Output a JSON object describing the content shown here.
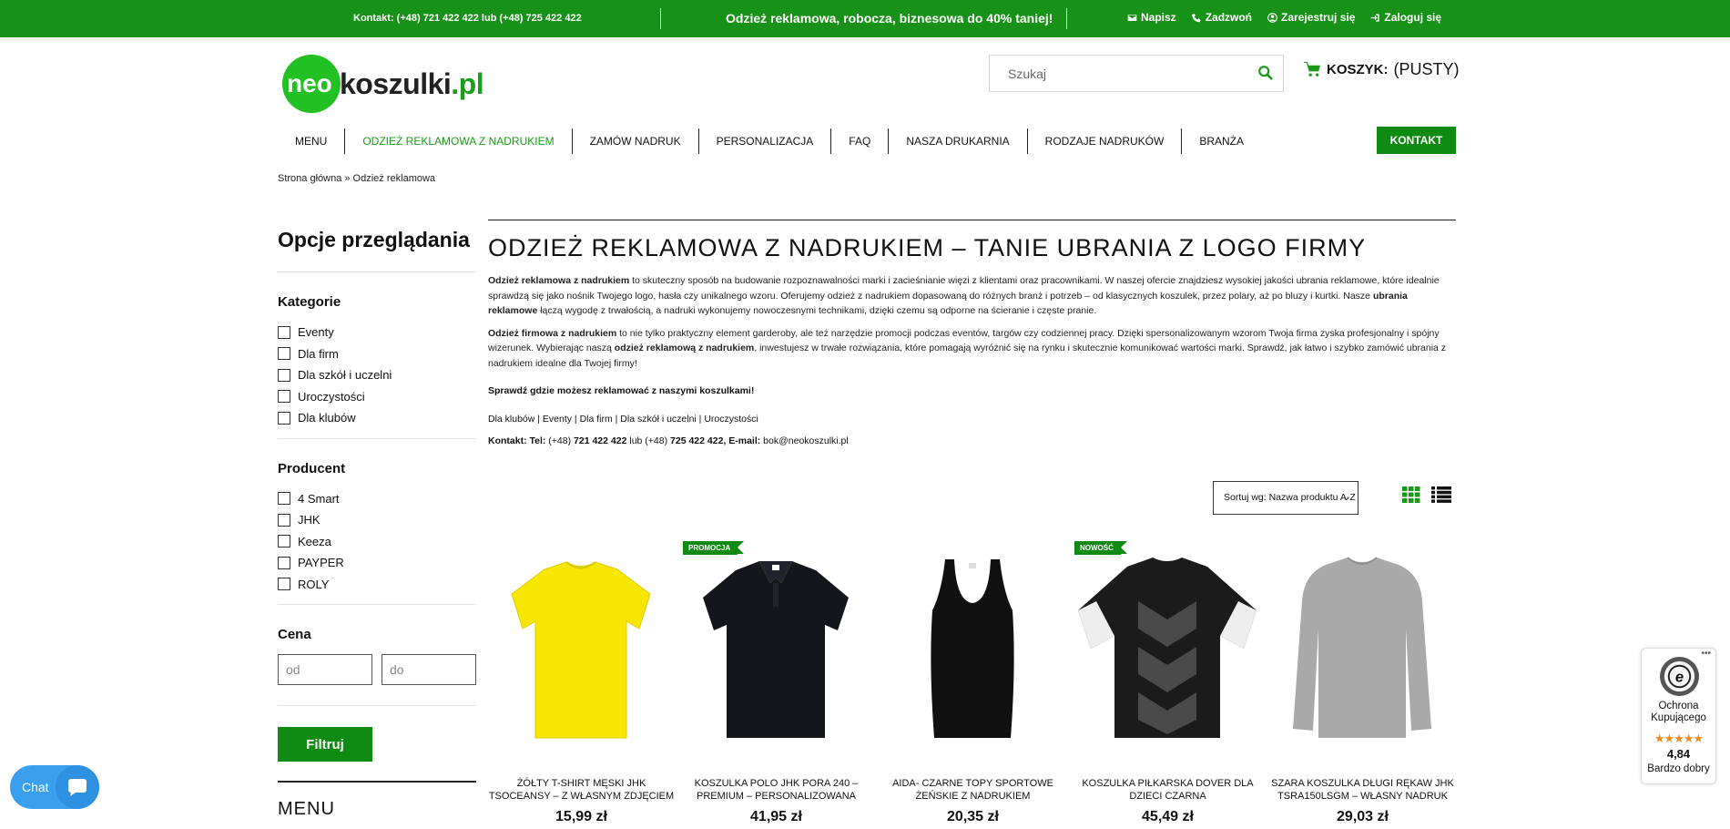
{
  "topbar": {
    "contact": "Kontakt: (+48) 721 422 422 lub (+48) 725 422 422",
    "promo": "Odzież reklamowa, robocza, biznesowa do 40% taniej!",
    "links": {
      "write": "Napisz",
      "call": "Zadzwoń",
      "register": "Zarejestruj się",
      "login": "Zaloguj się"
    }
  },
  "logo": {
    "part1": "neo",
    "part2": "koszulki",
    "part3": ".pl"
  },
  "search": {
    "placeholder": "Szukaj"
  },
  "cart": {
    "label": "KOSZYK:",
    "value": "(PUSTY)"
  },
  "nav": {
    "items": [
      "MENU",
      "ODZIEŻ REKLAMOWA Z NADRUKIEM",
      "ZAMÓW NADRUK",
      "PERSONALIZACJA",
      "FAQ",
      "NASZA DRUKARNIA",
      "RODZAJE NADRUKÓW",
      "BRANŻA"
    ],
    "contact_button": "KONTAKT"
  },
  "breadcrumb": "Strona główna » Odzież reklamowa",
  "sidebar": {
    "title": "Opcje przeglądania",
    "categories_title": "Kategorie",
    "categories": [
      "Eventy",
      "Dla firm",
      "Dla szkół i uczelni",
      "Uroczystości",
      "Dla klubów"
    ],
    "producer_title": "Producent",
    "producers": [
      "4 Smart",
      "JHK",
      "Keeza",
      "PAYPER",
      "ROLY"
    ],
    "price_title": "Cena",
    "price_from": "od",
    "price_to": "do",
    "filter_button": "Filtruj",
    "menu_title": "MENU"
  },
  "main": {
    "title": "ODZIEŻ REKLAMOWA Z NADRUKIEM – TANIE UBRANIA Z LOGO FIRMY",
    "p1_b1": "Odzież reklamowa z nadrukiem",
    "p1_t1": " to skuteczny sposób na budowanie rozpoznawalności marki i zacieśnianie więzi z klientami oraz pracownikami. W naszej ofercie znajdziesz wysokiej jakości ubrania reklamowe, które idealnie sprawdzą się jako nośnik Twojego logo, hasła czy unikalnego wzoru. Oferujemy odzież z nadrukiem dopasowaną do różnych branż i potrzeb – od klasycznych koszulek, przez polary, aż po bluzy i kurtki. Nasze ",
    "p1_b2": "ubrania reklamowe",
    "p1_t2": " łączą wygodę z trwałością, a nadruki wykonujemy nowoczesnymi technikami, dzięki czemu są odporne na ścieranie i częste pranie.",
    "p2_b1": "Odzież firmowa z nadrukiem",
    "p2_t1": " to nie tylko praktyczny element garderoby, ale też narzędzie promocji podczas eventów, targów czy codziennej pracy. Dzięki spersonalizowanym wzorom Twoja firma zyska profesjonalny i spójny wizerunek. Wybierając naszą ",
    "p2_b2": "odzież reklamową z nadrukiem",
    "p2_t2": ", inwestujesz w trwałe rozwiązania, które pomagają wyróżnić się na rynku i skutecznie komunikować wartości marki. Sprawdź, jak łatwo i szybko zamówić ubrania z nadrukiem idealne dla Twojej firmy!",
    "check_where": "Sprawdź gdzie możesz reklamować z naszymi koszulkami!",
    "links_line": "Dla klubów | Eventy | Dla firm | Dla szkół i uczelni | Uroczystości",
    "contact_label": "Kontakt: Tel:",
    "contact_phone1_prefix": " (+48) ",
    "contact_phone1": "721 422 422",
    "contact_mid": " lub (+48) ",
    "contact_phone2": "725 422 422",
    "contact_email_label": ",  E-mail:",
    "contact_email": " bok@neokoszulki.pl"
  },
  "sort": {
    "label": "Sortuj wg: Nazwa produktu A-Z"
  },
  "products": [
    {
      "name": "ŻÓŁTY T-SHIRT MĘSKI JHK TSOCEANSY – Z WŁASNYM ZDJĘCIEM",
      "price": "15,99 zł",
      "badge": "",
      "color": "#f7e600"
    },
    {
      "name": "KOSZULKA POLO JHK PORA 240 – PREMIUM – PERSONALIZOWANA",
      "price": "41,95 zł",
      "badge": "PROMOCJA",
      "color": "#15151c"
    },
    {
      "name": "AIDA- CZARNE TOPY SPORTOWE ŻEŃSKIE Z NADRUKIEM",
      "price": "20,35 zł",
      "badge": "",
      "color": "#111111"
    },
    {
      "name": "KOSZULKA PIŁKARSKA DOVER DLA DZIECI CZARNA",
      "price": "45,49 zł",
      "badge": "NOWOŚĆ",
      "color": "#1b1b1b"
    },
    {
      "name": "SZARA KOSZULKA DŁUGI RĘKAW JHK TSRA150LSGM – WŁASNY NADRUK",
      "price": "29,03 zł",
      "badge": "",
      "color": "#a9a9a9"
    }
  ],
  "trust": {
    "line1": "Ochrona",
    "line2": "Kupującego",
    "stars": "★★★★★",
    "score": "4,84",
    "word": "Bardzo dobry"
  },
  "chat": {
    "label": "Chat"
  },
  "colors": {
    "brand_green": "#179117",
    "button_green": "#0f8a13",
    "chat_blue": "#3aa0ee",
    "star_orange": "#f08a24"
  }
}
